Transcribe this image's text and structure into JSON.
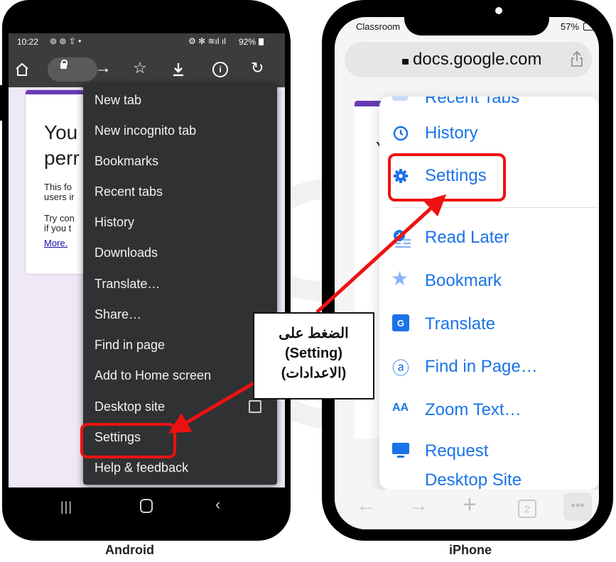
{
  "android": {
    "status": {
      "time": "10:22",
      "battery": "92%"
    },
    "page": {
      "heading_line1": "You",
      "heading_line2": "perr",
      "body1": "This fo\nusers ir",
      "body2": "Try con\nif you t",
      "link": "More."
    },
    "menu": {
      "items": [
        "New tab",
        "New incognito tab",
        "Bookmarks",
        "Recent tabs",
        "History",
        "Downloads",
        "Translate…",
        "Share…",
        "Find in page",
        "Add to Home screen",
        "Desktop site",
        "Settings",
        "Help & feedback"
      ]
    },
    "caption": "Android"
  },
  "iphone": {
    "status": {
      "carrier": "Classroom",
      "battery": "57%"
    },
    "url": "docs.google.com",
    "menu": {
      "items": [
        "Recent Tabs",
        "History",
        "Settings",
        "Read Later",
        "Bookmark",
        "Translate",
        "Find in Page…",
        "Zoom Text…",
        "Request",
        "Desktop Site"
      ]
    },
    "toolbar": {
      "tab_count": "2"
    },
    "caption": "iPhone"
  },
  "callout": {
    "line1": "الضغط على",
    "line2": "(Setting)",
    "line3": "(الاعدادات)"
  },
  "colors": {
    "highlight": "#ee1111",
    "ios_blue": "#1a73e8",
    "android_menu": "#303133"
  }
}
